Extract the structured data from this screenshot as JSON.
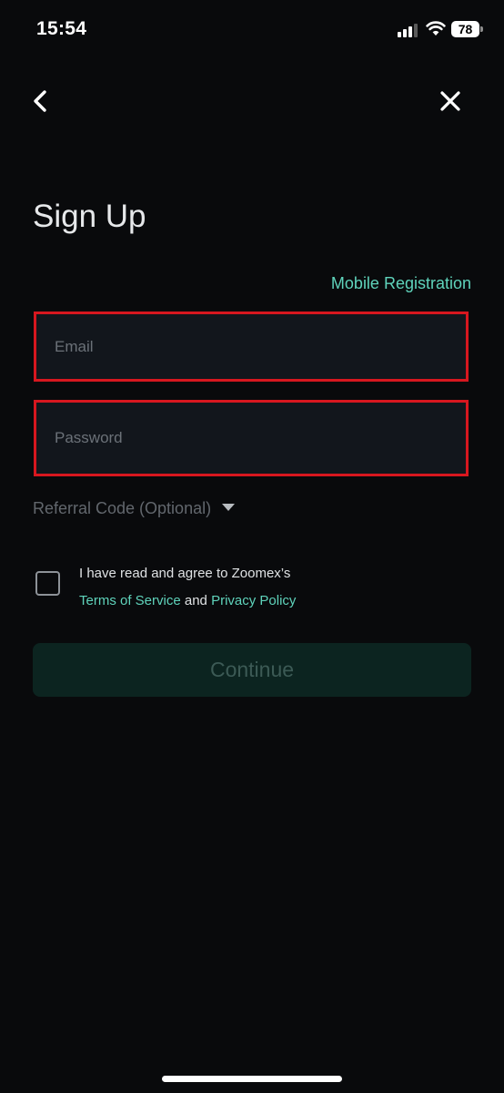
{
  "status_bar": {
    "time": "15:54",
    "battery_level": "78",
    "signal_bars_filled": 3,
    "signal_bars_total": 4
  },
  "nav": {
    "back_icon": "chevron-left-icon",
    "close_icon": "close-icon"
  },
  "page": {
    "title": "Sign Up",
    "switch_link": "Mobile Registration"
  },
  "form": {
    "email_placeholder": "Email",
    "email_value": "",
    "password_placeholder": "Password",
    "password_value": "",
    "referral_label": "Referral Code (Optional)",
    "agree_checked": false,
    "agree_text": "I have read and agree to Zoomex’s",
    "terms_label": "Terms of Service",
    "and_text": "and",
    "privacy_label": "Privacy Policy",
    "continue_label": "Continue"
  },
  "colors": {
    "background": "#090a0c",
    "accent": "#5fd3bb",
    "highlight_border": "#d7171f",
    "button_disabled_bg": "#0c2420"
  }
}
